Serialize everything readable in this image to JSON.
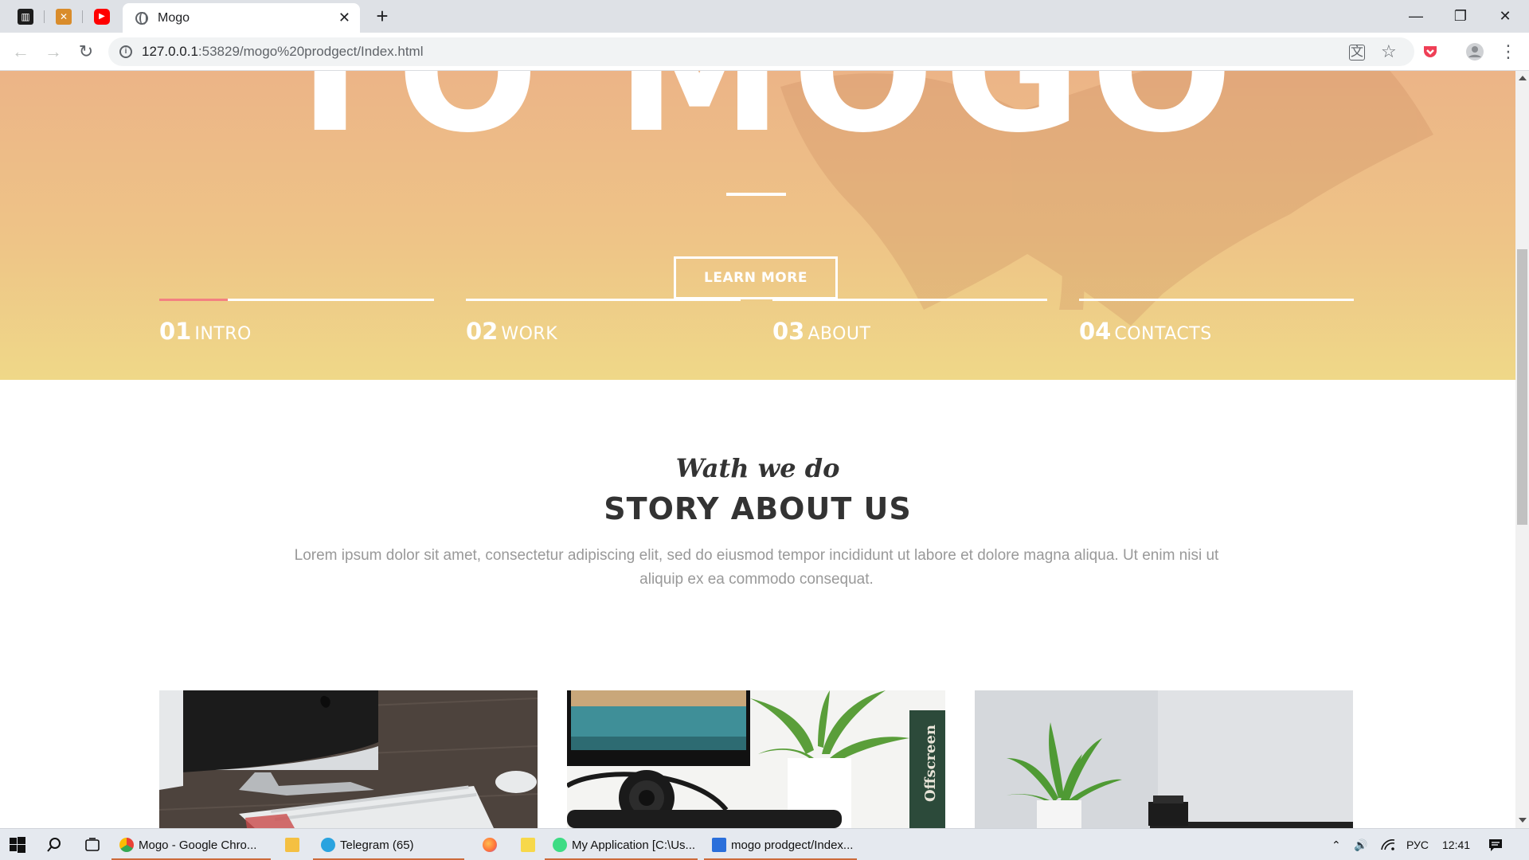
{
  "browser": {
    "pinned_tabs": [
      {
        "icon": "trello-icon",
        "color": "#1d1d1d",
        "glyph": "▥"
      },
      {
        "icon": "crossed-tools-icon",
        "color": "#d98c2b",
        "glyph": "✕"
      },
      {
        "icon": "youtube-icon",
        "color": "#ff0000",
        "glyph": "▶"
      }
    ],
    "active_tab": {
      "title": "Mogo",
      "icon": "globe-icon"
    },
    "new_tab_glyph": "+",
    "window_controls": {
      "minimize": "—",
      "restore": "❐",
      "close": "✕"
    },
    "nav": {
      "back": "←",
      "forward": "→",
      "reload": "↻"
    },
    "url_host": "127.0.0.1",
    "url_rest": ":53829/mogo%20prodgect/Index.html",
    "translate_glyph": "文",
    "bookmark_glyph": "☆",
    "menu_glyph": "⋮"
  },
  "hero": {
    "title": "TO MOGO",
    "button_label": "LEARN MORE",
    "slides": [
      {
        "num": "01",
        "name": "INTRO",
        "progress": 0.25
      },
      {
        "num": "02",
        "name": "WORK",
        "progress": 0
      },
      {
        "num": "03",
        "name": "ABOUT",
        "progress": 0
      },
      {
        "num": "04",
        "name": "CONTACTS",
        "progress": 0
      }
    ],
    "colors": {
      "accent": "#f38181",
      "gradient_top": "#ecb487",
      "gradient_bottom": "#efd888"
    }
  },
  "story": {
    "script_title": "Wath we do",
    "title": "STORY ABOUT US",
    "text": "Lorem ipsum dolor sit amet, consectetur adipiscing elit, sed do eiusmod tempor incididunt ut labore et dolore magna aliqua. Ut enim nisi ut aliquip ex ea commodo consequat.",
    "cards": [
      {
        "image": "desk-computer-keyboard-photo"
      },
      {
        "image": "headphones-plant-books-photo",
        "book_text": "Offscreen"
      },
      {
        "image": "plant-camera-photo"
      }
    ]
  },
  "taskbar": {
    "apps": [
      {
        "label": "Mogo - Google Chro...",
        "icon": "chrome-icon",
        "color": "#e94235"
      },
      {
        "label": "",
        "icon": "file-explorer-icon",
        "color": "#f4c042"
      },
      {
        "label": "Telegram (65)",
        "icon": "telegram-icon",
        "color": "#2aa3df"
      },
      {
        "label": "",
        "icon": "firefox-icon",
        "color": "#ff7139"
      },
      {
        "label": "",
        "icon": "sticky-notes-icon",
        "color": "#f7d84a"
      },
      {
        "label": "My Application [C:\\Us...",
        "icon": "android-studio-icon",
        "color": "#3ddc84"
      },
      {
        "label": "mogo prodgect/Index...",
        "icon": "brackets-icon",
        "color": "#2a6fdb"
      }
    ],
    "language": "РУС",
    "time": "12:41"
  }
}
